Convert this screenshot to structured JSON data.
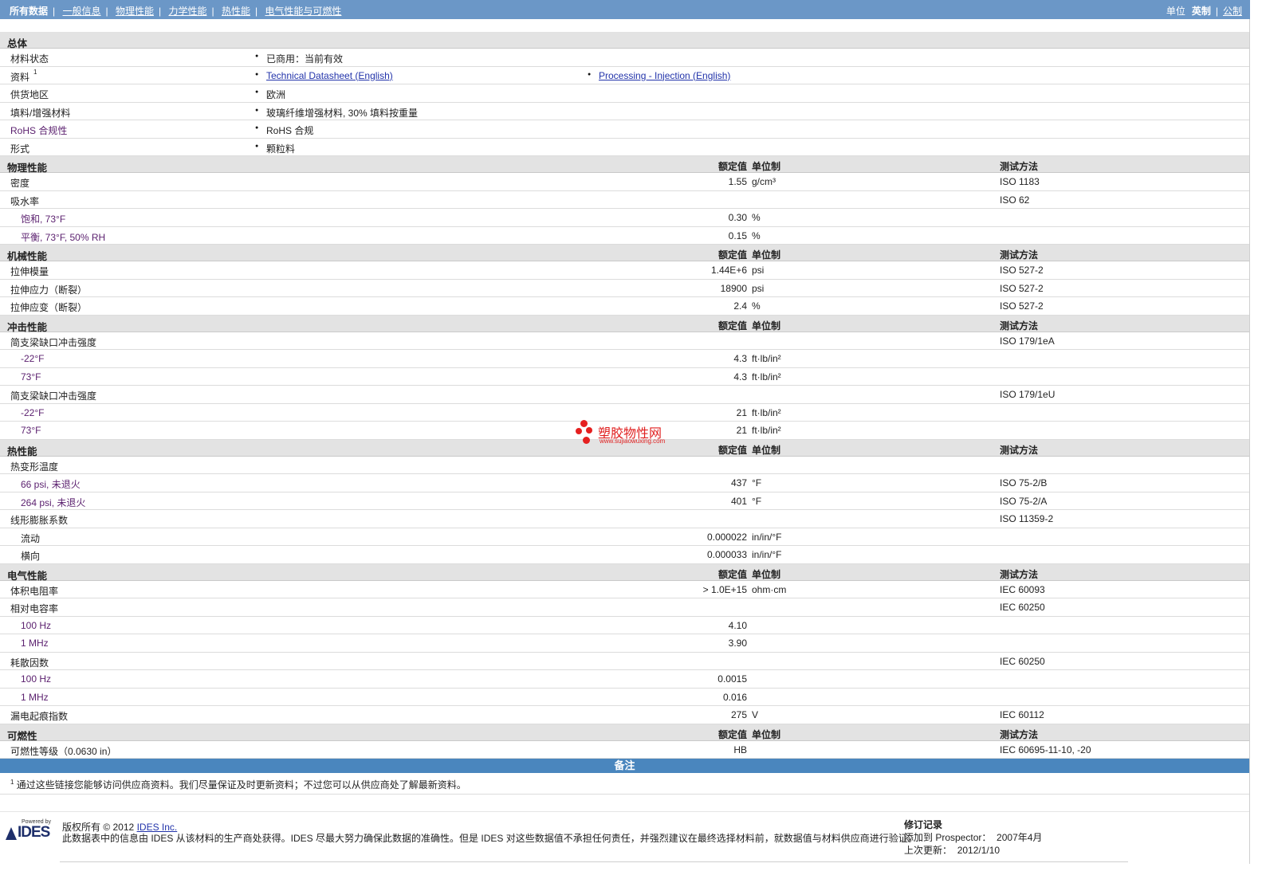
{
  "nav": {
    "tabs": [
      "所有数据",
      "一般信息",
      "物理性能",
      "力学性能",
      "热性能",
      "电气性能与可燃性"
    ],
    "unit_label": "单位",
    "unit_options": [
      "英制",
      "公制"
    ]
  },
  "general": {
    "title": "总体",
    "rows": [
      {
        "label": "材料状态",
        "values": [
          "已商用：当前有效"
        ]
      },
      {
        "label": "资料",
        "sup": "1",
        "values": [
          "Technical Datasheet (English)",
          "Processing - Injection (English)"
        ],
        "links": true
      },
      {
        "label": "供货地区",
        "values": [
          "欧洲"
        ]
      },
      {
        "label": "填料/增强材料",
        "values": [
          "玻璃纤维增强材料, 30% 填料按重量"
        ]
      },
      {
        "label": "RoHS 合规性",
        "values": [
          "RoHS 合规"
        ]
      },
      {
        "label": "形式",
        "values": [
          "颗粒料"
        ]
      }
    ]
  },
  "headers": {
    "value": "额定值",
    "unit": "单位制",
    "method": "测试方法"
  },
  "sections": [
    {
      "title": "物理性能",
      "rows": [
        {
          "name": "密度",
          "value": "1.55",
          "unit": "g/cm³",
          "method": "ISO 1183"
        },
        {
          "name": "吸水率",
          "value": "",
          "unit": "",
          "method": "ISO 62"
        },
        {
          "name": "饱和, 73°F",
          "indent": true,
          "value": "0.30",
          "unit": "%",
          "method": ""
        },
        {
          "name": "平衡, 73°F, 50% RH",
          "indent": true,
          "value": "0.15",
          "unit": "%",
          "method": ""
        }
      ]
    },
    {
      "title": "机械性能",
      "rows": [
        {
          "name": "拉伸模量",
          "value": "1.44E+6",
          "unit": "psi",
          "method": "ISO 527-2"
        },
        {
          "name": "拉伸应力（断裂）",
          "value": "18900",
          "unit": "psi",
          "method": "ISO 527-2"
        },
        {
          "name": "拉伸应变（断裂）",
          "value": "2.4",
          "unit": "%",
          "method": "ISO 527-2"
        }
      ]
    },
    {
      "title": "冲击性能",
      "rows": [
        {
          "name": "简支梁缺口冲击强度",
          "value": "",
          "unit": "",
          "method": "ISO 179/1eA"
        },
        {
          "name": "-22°F",
          "indent": true,
          "value": "4.3",
          "unit": "ft·lb/in²",
          "method": ""
        },
        {
          "name": "73°F",
          "indent": true,
          "value": "4.3",
          "unit": "ft·lb/in²",
          "method": ""
        },
        {
          "name": "简支梁缺口冲击强度",
          "value": "",
          "unit": "",
          "method": "ISO 179/1eU"
        },
        {
          "name": "-22°F",
          "indent": true,
          "value": "21",
          "unit": "ft·lb/in²",
          "method": ""
        },
        {
          "name": "73°F",
          "indent": true,
          "value": "21",
          "unit": "ft·lb/in²",
          "method": ""
        }
      ]
    },
    {
      "title": "热性能",
      "rows": [
        {
          "name": "热变形温度",
          "value": "",
          "unit": "",
          "method": ""
        },
        {
          "name": "66 psi, 未退火",
          "indent": true,
          "value": "437",
          "unit": "°F",
          "method": "ISO 75-2/B"
        },
        {
          "name": "264 psi, 未退火",
          "indent": true,
          "value": "401",
          "unit": "°F",
          "method": "ISO 75-2/A"
        },
        {
          "name": "线形膨胀系数",
          "value": "",
          "unit": "",
          "method": "ISO 11359-2"
        },
        {
          "name": "流动",
          "indent": true,
          "value": "0.000022",
          "unit": "in/in/°F",
          "method": ""
        },
        {
          "name": "横向",
          "indent": true,
          "value": "0.000033",
          "unit": "in/in/°F",
          "method": ""
        }
      ]
    },
    {
      "title": "电气性能",
      "rows": [
        {
          "name": "体积电阻率",
          "value": "> 1.0E+15",
          "unit": "ohm·cm",
          "method": "IEC 60093"
        },
        {
          "name": "相对电容率",
          "value": "",
          "unit": "",
          "method": "IEC 60250"
        },
        {
          "name": "100 Hz",
          "indent": true,
          "value": "4.10",
          "unit": "",
          "method": ""
        },
        {
          "name": "1 MHz",
          "indent": true,
          "value": "3.90",
          "unit": "",
          "method": ""
        },
        {
          "name": "耗散因数",
          "value": "",
          "unit": "",
          "method": "IEC 60250"
        },
        {
          "name": "100 Hz",
          "indent": true,
          "value": "0.0015",
          "unit": "",
          "method": ""
        },
        {
          "name": "1 MHz",
          "indent": true,
          "value": "0.016",
          "unit": "",
          "method": ""
        },
        {
          "name": "漏电起痕指数",
          "value": "275",
          "unit": "V",
          "method": "IEC 60112"
        }
      ]
    },
    {
      "title": "可燃性",
      "rows": [
        {
          "name": "可燃性等级（0.0630 in）",
          "value": "HB",
          "unit": "",
          "method": "IEC 60695-11-10, -20"
        }
      ]
    }
  ],
  "notes": {
    "title": "备注",
    "sup": "1",
    "text": "通过这些链接您能够访问供应商资料。我们尽量保证及时更新资料；不过您可以从供应商处了解最新资料。"
  },
  "footer": {
    "logo_powered": "Powered by",
    "logo_name": "IDES",
    "copyright_prefix": "版权所有 © 2012",
    "copyright_link": "IDES Inc.",
    "disclaimer": "此数据表中的信息由 IDES 从该材料的生产商处获得。IDES 尽最大努力确保此数据的准确性。但是 IDES 对这些数据值不承担任何责任，并强烈建议在最终选择材料前，就数据值与材料供应商进行验证。",
    "revision_title": "修订记录",
    "added_label": "添加到 Prospector：",
    "added_value": "2007年4月",
    "updated_label": "上次更新：",
    "updated_value": "2012/1/10"
  },
  "watermark": {
    "title": "塑胶物性网",
    "url": "www.sujiaowuxing.com"
  }
}
